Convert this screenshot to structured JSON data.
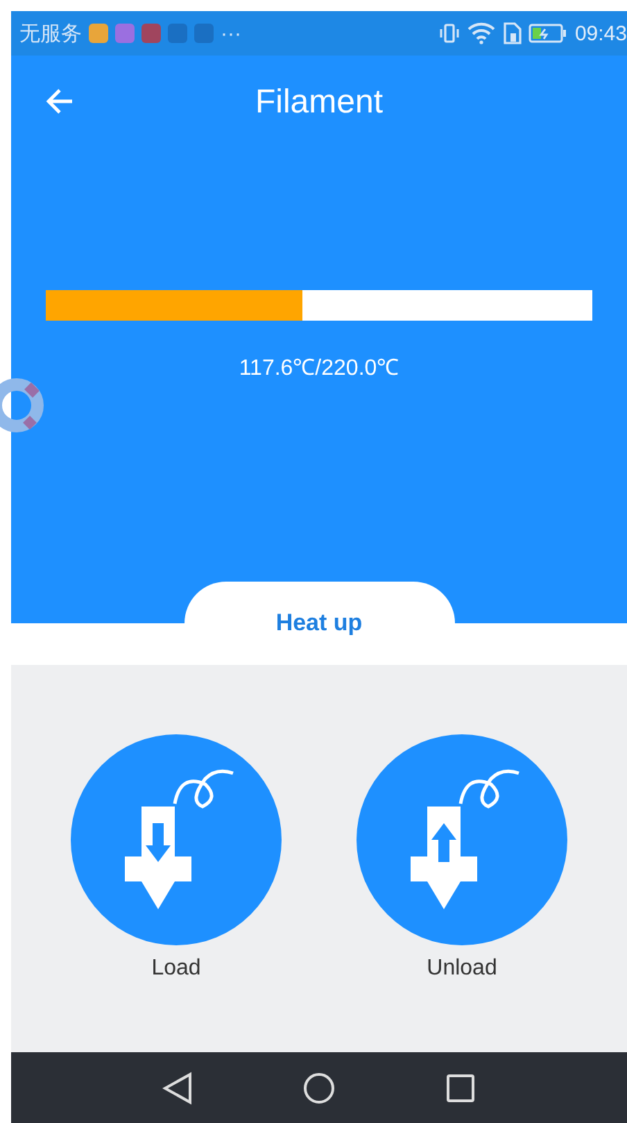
{
  "status_bar": {
    "carrier": "无服务",
    "notification_icons": [
      {
        "color": "#e8a53a"
      },
      {
        "color": "#9b6fe0"
      },
      {
        "color": "#a0455e"
      },
      {
        "color": "#1a6fc2"
      },
      {
        "color": "#1a6fc2"
      }
    ],
    "overflow": "···",
    "time": "09:43"
  },
  "app_bar": {
    "title": "Filament"
  },
  "heater": {
    "level": 0.47,
    "reading": "117.6℃/220.0℃",
    "button": "Heat up"
  },
  "actions": [
    {
      "kind": "load",
      "label": "Load"
    },
    {
      "kind": "unload",
      "label": "Unload"
    }
  ]
}
